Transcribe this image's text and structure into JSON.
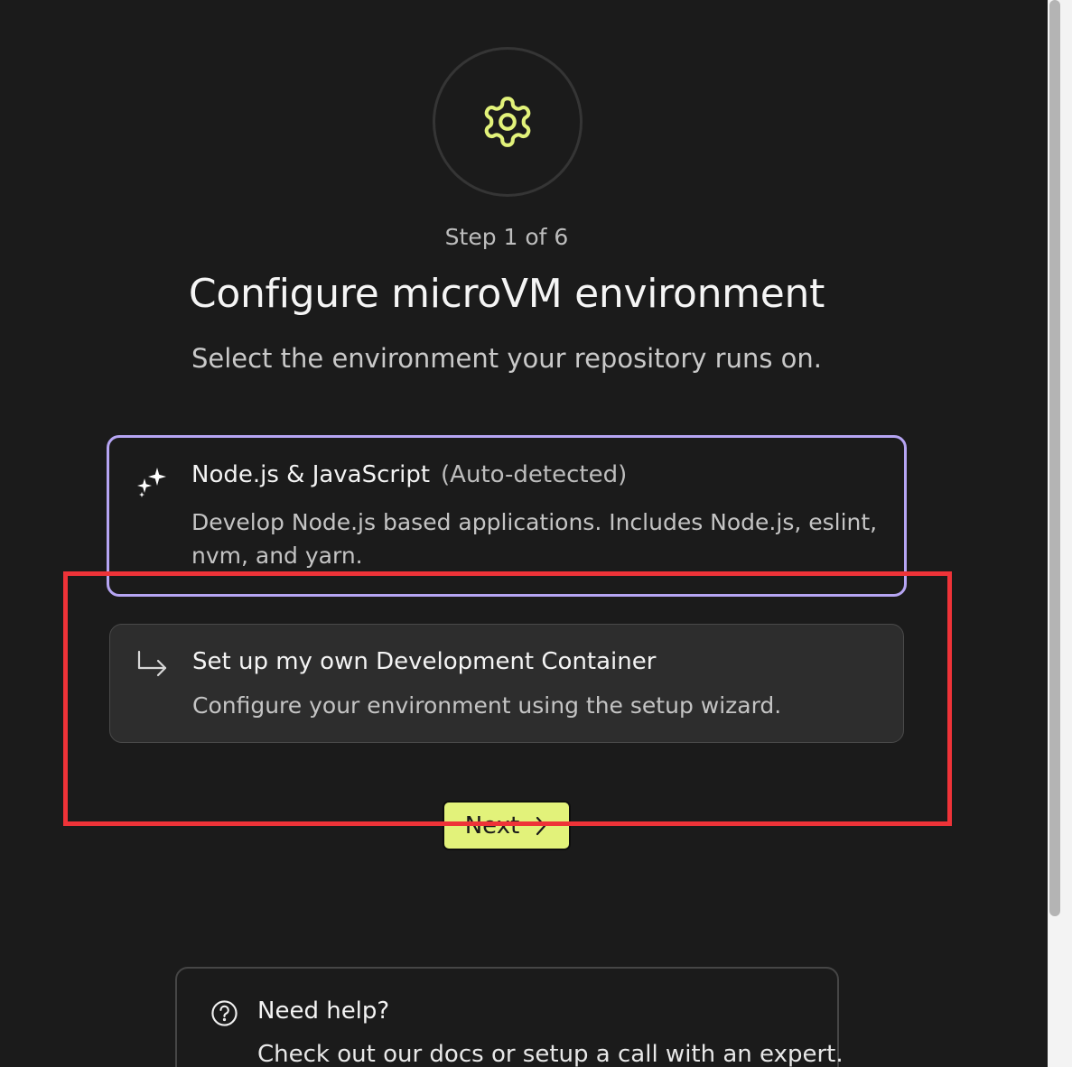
{
  "wizard": {
    "step_label": "Step 1 of 6",
    "title": "Configure microVM environment",
    "subtitle": "Select the environment your repository runs on."
  },
  "options": [
    {
      "title": "Node.js & JavaScript",
      "badge": "(Auto-detected)",
      "description": "Develop Node.js based applications. Includes Node.js, eslint, nvm, and yarn.",
      "icon": "sparkles-icon",
      "selected": true
    },
    {
      "title": "Set up my own Development Container",
      "description": "Configure your environment using the setup wizard.",
      "icon": "arrow-return-right-icon",
      "selected": false
    }
  ],
  "next_button": {
    "label": "Next"
  },
  "help": {
    "title": "Need help?",
    "description": "Check out our docs or setup a call with an expert."
  },
  "colors": {
    "background": "#1b1b1b",
    "accent": "#e2f27a",
    "selected_border": "#b6a5f3",
    "gear_icon": "#e2f27a",
    "highlight_box": "#ee3338"
  }
}
